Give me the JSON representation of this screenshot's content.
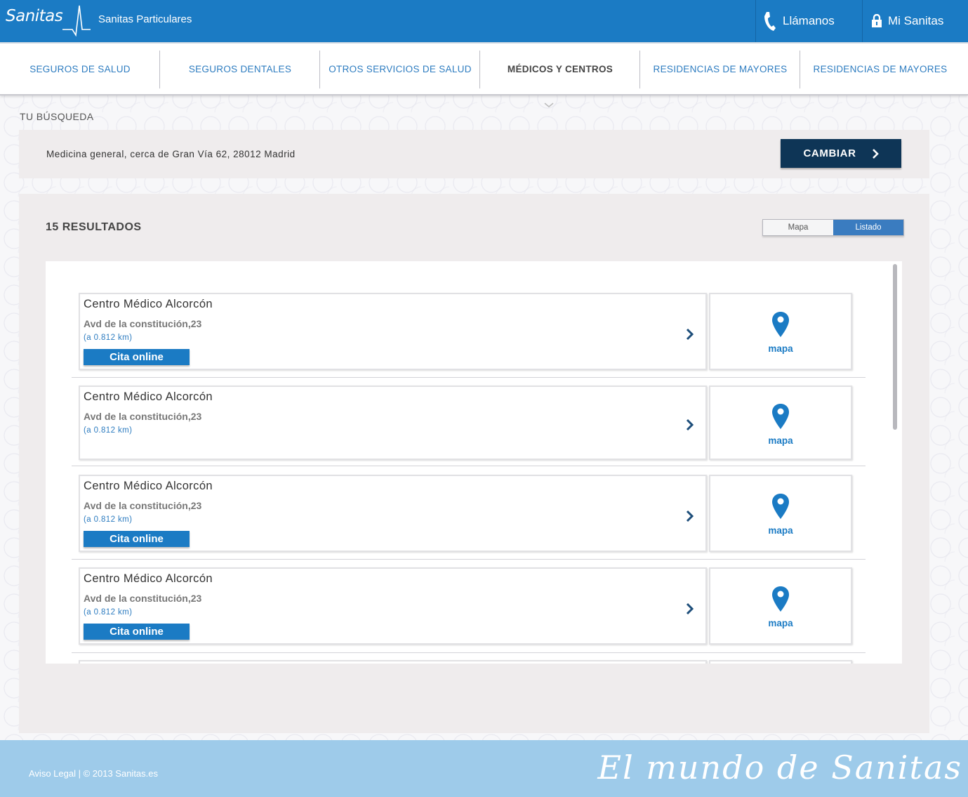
{
  "header": {
    "brand": "Sanitas",
    "subtitle": "Sanitas Particulares",
    "call_label": "Llámanos",
    "account_label": "Mi Sanitas"
  },
  "nav": {
    "items": [
      {
        "label": "SEGUROS DE SALUD",
        "active": false
      },
      {
        "label": "SEGUROS DENTALES",
        "active": false
      },
      {
        "label": "OTROS SERVICIOS DE SALUD",
        "active": false
      },
      {
        "label": "MÉDICOS Y CENTROS",
        "active": true
      },
      {
        "label": "RESIDENCIAS DE MAYORES",
        "active": false
      },
      {
        "label": "RESIDENCIAS DE MAYORES",
        "active": false
      }
    ]
  },
  "search": {
    "section_label": "TU BÚSQUEDA",
    "query": "Medicina general, cerca de Gran Vía 62, 28012 Madrid",
    "change_button": "CAMBIAR"
  },
  "results": {
    "count_label": "15 RESULTADOS",
    "view_toggle": {
      "map": "Mapa",
      "list": "Listado",
      "selected": "Listado"
    },
    "items": [
      {
        "name": "Centro Médico Alcorcón",
        "address": "Avd de la constitución,23",
        "distance": "(a 0.812 km)",
        "cta": "Cita online",
        "map_label": "mapa"
      },
      {
        "name": "Centro Médico Alcorcón",
        "address": "Avd de la constitución,23",
        "distance": "(a 0.812 km)",
        "cta": "",
        "map_label": "mapa"
      },
      {
        "name": "Centro Médico Alcorcón",
        "address": "Avd de la constitución,23",
        "distance": "(a 0.812 km)",
        "cta": "Cita online",
        "map_label": "mapa"
      },
      {
        "name": "Centro Médico Alcorcón",
        "address": "Avd de la constitución,23",
        "distance": "(a 0.812 km)",
        "cta": "Cita online",
        "map_label": "mapa"
      }
    ]
  },
  "footer": {
    "legal": "Aviso Legal | © 2013 Sanitas.es",
    "tagline": "El mundo de Sanitas"
  },
  "colors": {
    "brand_blue": "#1b7bc4",
    "dark_navy": "#0e3556",
    "footer_blue": "#9ecbea"
  }
}
